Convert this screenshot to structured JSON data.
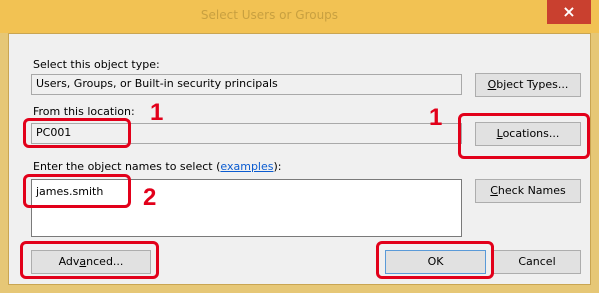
{
  "window": {
    "title": "Select Users or Groups",
    "close_glyph": "×"
  },
  "object_type": {
    "label": "Select this object type:",
    "value": "Users, Groups, or Built-in security principals",
    "button": {
      "accel": "O",
      "rest": "bject Types..."
    }
  },
  "location": {
    "label": "From this location:",
    "value": "PC001",
    "button": {
      "accel": "L",
      "rest": "ocations..."
    }
  },
  "names": {
    "label_before": "Enter the object names to select (",
    "examples_link": "examples",
    "label_after": "):",
    "value": "james.smith",
    "check_button": {
      "accel": "C",
      "rest": "heck Names"
    }
  },
  "footer": {
    "advanced": {
      "before": "Adv",
      "accel": "a",
      "rest": "nced..."
    },
    "ok": "OK",
    "cancel": "Cancel"
  },
  "callouts": {
    "one_a": "1",
    "one_b": "1",
    "two": "2"
  },
  "colors": {
    "highlight": "#e2001a",
    "link": "#0a5bd0"
  }
}
